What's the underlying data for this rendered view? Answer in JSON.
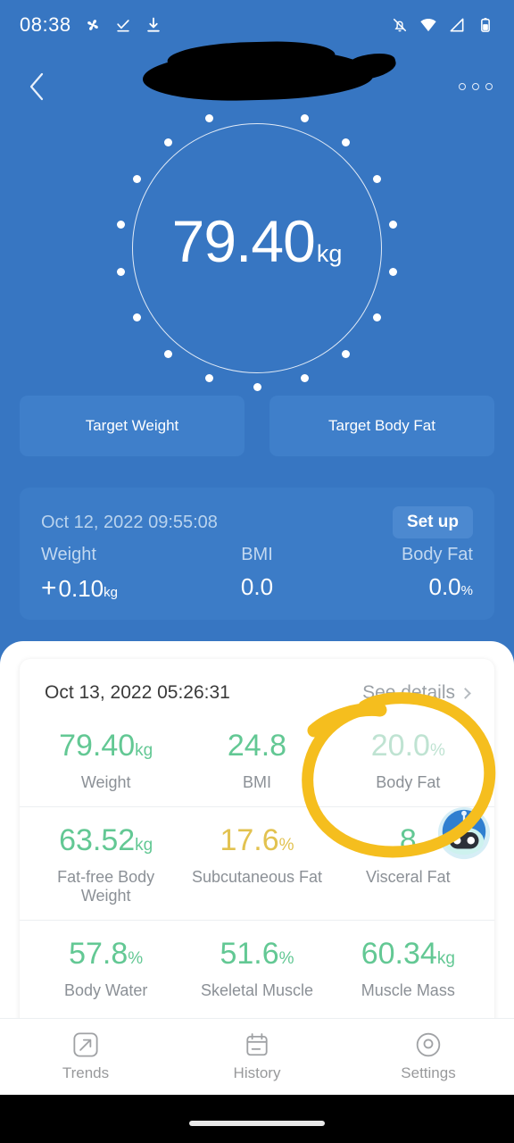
{
  "statusbar": {
    "time": "08:38",
    "icons_left": [
      "pinwheel-icon",
      "checkmark-underline-icon",
      "download-icon"
    ],
    "icons_right": [
      "notifications-muted-icon",
      "wifi-icon",
      "cellular-signal-icon",
      "battery-icon"
    ]
  },
  "header": {
    "back_icon": "back-chevron-icon",
    "title": "",
    "title_redacted": true,
    "menu_icon": "overflow-menu-icon"
  },
  "dial": {
    "value": "79.40",
    "unit": "kg"
  },
  "targets": [
    {
      "label": "Target Weight"
    },
    {
      "label": "Target Body Fat"
    }
  ],
  "compare": {
    "date": "Oct 12, 2022 09:55:08",
    "setup_label": "Set up",
    "metrics": [
      {
        "label": "Weight",
        "sign": "+",
        "value": "0.10",
        "unit": "kg"
      },
      {
        "label": "BMI",
        "sign": "",
        "value": "0.0",
        "unit": ""
      },
      {
        "label": "Body Fat",
        "sign": "",
        "value": "0.0",
        "unit": "%"
      }
    ]
  },
  "details": {
    "date": "Oct 13, 2022 05:26:31",
    "see_details_label": "See details",
    "rows": [
      [
        {
          "value": "79.40",
          "unit": "kg",
          "label": "Weight",
          "tone": "green"
        },
        {
          "value": "24.8",
          "unit": "",
          "label": "BMI",
          "tone": "green"
        },
        {
          "value": "20.0",
          "unit": "%",
          "label": "Body Fat",
          "tone": "faded"
        }
      ],
      [
        {
          "value": "63.52",
          "unit": "kg",
          "label": "Fat-free Body Weight",
          "tone": "green"
        },
        {
          "value": "17.6",
          "unit": "%",
          "label": "Subcutaneous Fat",
          "tone": "amber"
        },
        {
          "value": "8",
          "unit": "",
          "label": "Visceral Fat",
          "tone": "green"
        }
      ],
      [
        {
          "value": "57.8",
          "unit": "%",
          "label": "Body Water",
          "tone": "green"
        },
        {
          "value": "51.6",
          "unit": "%",
          "label": "Skeletal Muscle",
          "tone": "green"
        },
        {
          "value": "60.34",
          "unit": "kg",
          "label": "Muscle Mass",
          "tone": "green"
        }
      ]
    ]
  },
  "assistant": {
    "icon": "robot-assistant-avatar"
  },
  "annotation": {
    "shape": "hand-drawn-circle",
    "color": "#f5be1e",
    "targets": "body-fat-metric"
  },
  "bottomnav": [
    {
      "label": "Trends",
      "icon": "trending-arrow-icon"
    },
    {
      "label": "History",
      "icon": "calendar-icon"
    },
    {
      "label": "Settings",
      "icon": "circle-gear-icon"
    }
  ],
  "colors": {
    "background_blue": "#3776c2",
    "card_blue": "#3c7cc7",
    "button_blue": "#3f7fca",
    "green": "#63c894",
    "amber": "#e2c250",
    "faded_green": "#bfe3d2",
    "annotation_yellow": "#f5be1e"
  }
}
